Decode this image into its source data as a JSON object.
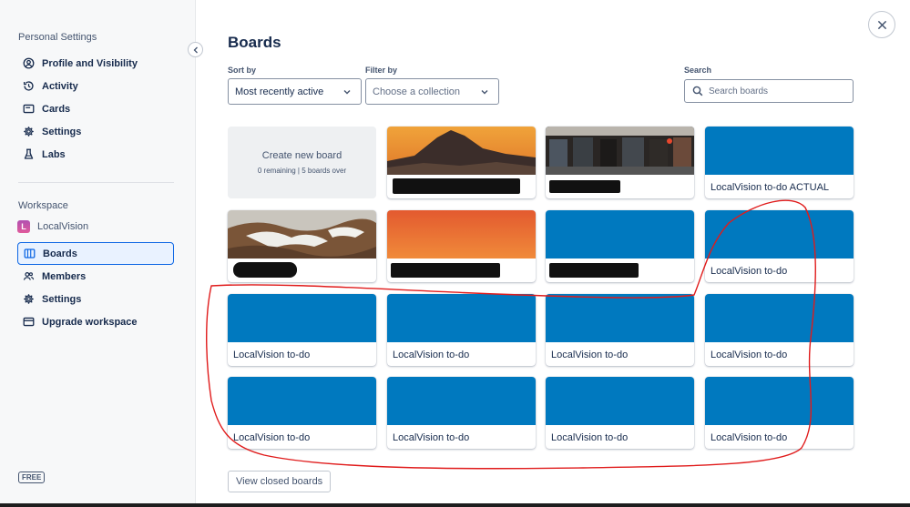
{
  "sidebar": {
    "personal_title": "Personal Settings",
    "personal_items": [
      {
        "label": "Profile and Visibility",
        "icon": "user-circle-icon"
      },
      {
        "label": "Activity",
        "icon": "history-icon"
      },
      {
        "label": "Cards",
        "icon": "card-icon"
      },
      {
        "label": "Settings",
        "icon": "gear-icon"
      },
      {
        "label": "Labs",
        "icon": "flask-icon"
      }
    ],
    "workspace_title": "Workspace",
    "workspace_initial": "L",
    "workspace_name": "LocalVision",
    "workspace_items": [
      {
        "label": "Boards",
        "icon": "boards-icon",
        "active": true
      },
      {
        "label": "Members",
        "icon": "members-icon"
      },
      {
        "label": "Settings",
        "icon": "gear-icon"
      },
      {
        "label": "Upgrade workspace",
        "icon": "credit-card-icon"
      }
    ],
    "plan_badge": "FREE"
  },
  "main": {
    "title": "Boards",
    "sort": {
      "label": "Sort by",
      "value": "Most recently active"
    },
    "filter": {
      "label": "Filter by",
      "placeholder": "Choose a collection"
    },
    "search": {
      "label": "Search",
      "placeholder": "Search boards"
    },
    "create_tile": {
      "title": "Create new board",
      "subtitle": "0 remaining | 5 boards over"
    },
    "boards": [
      {
        "name": "",
        "cover": "mountain-sunset-photo",
        "redacted": true
      },
      {
        "name": "",
        "cover": "storefront-photo",
        "redacted": true
      },
      {
        "name": "LocalVision to-do ACTUAL",
        "cover": "#0079bf"
      },
      {
        "name": "",
        "cover": "snowy-hills-photo",
        "redacted": true
      },
      {
        "name": "",
        "cover": "orange-gradient",
        "redacted": true
      },
      {
        "name": "",
        "cover": "#0079bf",
        "redacted": true
      },
      {
        "name": "LocalVision to-do",
        "cover": "#0079bf"
      },
      {
        "name": "LocalVision to-do",
        "cover": "#0079bf"
      },
      {
        "name": "LocalVision to-do",
        "cover": "#0079bf"
      },
      {
        "name": "LocalVision to-do",
        "cover": "#0079bf"
      },
      {
        "name": "LocalVision to-do",
        "cover": "#0079bf"
      },
      {
        "name": "LocalVision to-do",
        "cover": "#0079bf"
      },
      {
        "name": "LocalVision to-do",
        "cover": "#0079bf"
      },
      {
        "name": "LocalVision to-do",
        "cover": "#0079bf"
      },
      {
        "name": "LocalVision to-do",
        "cover": "#0079bf"
      }
    ],
    "view_closed_label": "View closed boards"
  },
  "colors": {
    "board_blue": "#0079bf",
    "accent": "#0c66e4",
    "annotation_red": "#e01b1b"
  }
}
